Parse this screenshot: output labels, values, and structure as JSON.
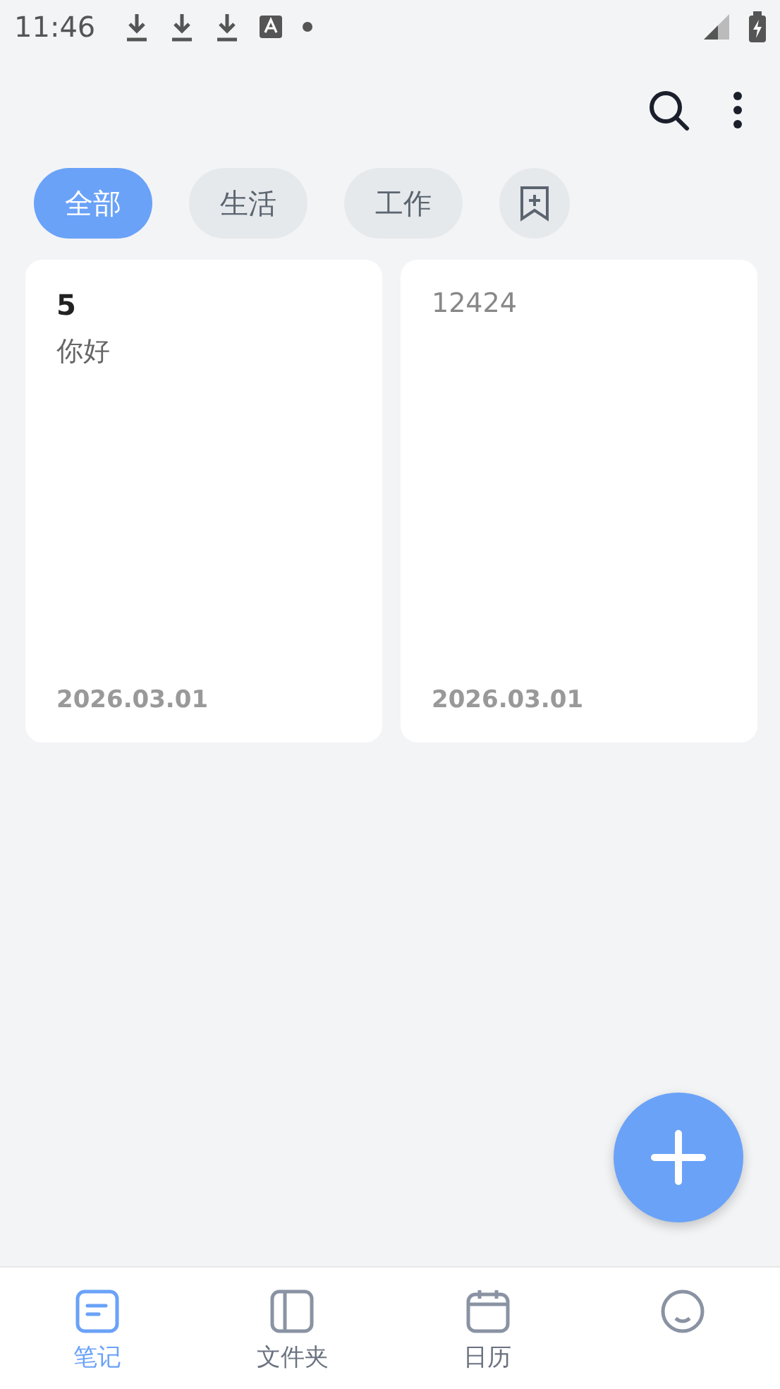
{
  "status_bar": {
    "time": "11:46"
  },
  "filters": [
    {
      "label": "全部",
      "selected": true
    },
    {
      "label": "生活",
      "selected": false
    },
    {
      "label": "工作",
      "selected": false
    }
  ],
  "notes": [
    {
      "title": "5",
      "body": "你好",
      "date": "2026.03.01"
    },
    {
      "body": "12424",
      "date": "2026.03.01"
    }
  ],
  "bottom_nav": [
    {
      "label": "笔记",
      "selected": true
    },
    {
      "label": "文件夹",
      "selected": false
    },
    {
      "label": "日历",
      "selected": false
    },
    {
      "selected": false
    }
  ]
}
